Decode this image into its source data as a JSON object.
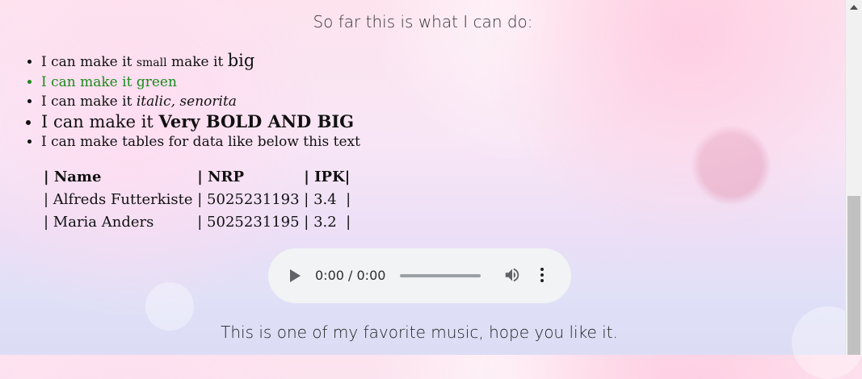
{
  "heading": "So far this is what I can do:",
  "features": {
    "item1": {
      "prefix": "I can make it ",
      "small": "small",
      "middle": " make it ",
      "big": "big"
    },
    "item2": "I can make it green",
    "item3": {
      "prefix": "I can make it ",
      "italic": "italic, senorita"
    },
    "item4": {
      "prefix": "I can make it ",
      "bold": "Very BOLD AND BIG"
    },
    "item5": "I can make tables for data like below this text"
  },
  "table": {
    "headers": [
      "| Name",
      "| NRP",
      "| IPK|"
    ],
    "rows": [
      [
        "| Alfreds Futterkiste ",
        "| 5025231193 ",
        "| 3.4  |"
      ],
      [
        "| Maria Anders",
        "| 5025231195 ",
        "| 3.2  |"
      ]
    ]
  },
  "audio": {
    "time": "0:00 / 0:00",
    "progress": 0,
    "icons": [
      "play-icon",
      "volume-icon",
      "more-options-icon"
    ]
  },
  "caption": "This is one of my favorite music, hope you like it.",
  "colors": {
    "green_text": "#1a8a1a",
    "audio_bg": "#f1f3f4"
  }
}
